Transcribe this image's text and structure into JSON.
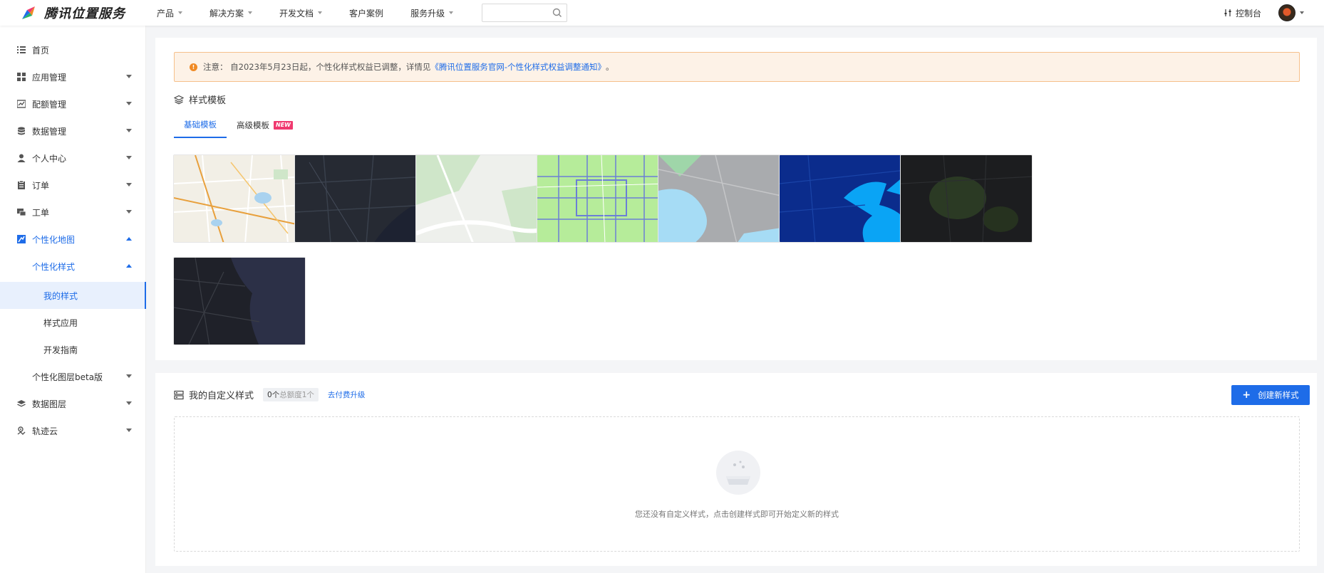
{
  "header": {
    "logo_text": "腾讯位置服务",
    "nav": [
      {
        "label": "产品",
        "has_caret": true
      },
      {
        "label": "解决方案",
        "has_caret": true
      },
      {
        "label": "开发文档",
        "has_caret": true
      },
      {
        "label": "客户案例",
        "has_caret": false
      },
      {
        "label": "服务升级",
        "has_caret": true
      }
    ],
    "search_placeholder": "",
    "console_label": "控制台"
  },
  "sidebar": {
    "items": [
      {
        "label": "首页",
        "icon": "list-icon"
      },
      {
        "label": "应用管理",
        "icon": "grid-icon"
      },
      {
        "label": "配额管理",
        "icon": "chart-icon"
      },
      {
        "label": "数据管理",
        "icon": "database-icon"
      },
      {
        "label": "个人中心",
        "icon": "user-icon"
      },
      {
        "label": "订单",
        "icon": "clipboard-icon"
      },
      {
        "label": "工单",
        "icon": "ticket-icon"
      },
      {
        "label": "个性化地图",
        "icon": "map-style-icon"
      },
      {
        "label": "个性化样式"
      },
      {
        "label": "我的样式"
      },
      {
        "label": "样式应用"
      },
      {
        "label": "开发指南"
      },
      {
        "label": "个性化图层beta版"
      },
      {
        "label": "数据图层",
        "icon": "layers-icon"
      },
      {
        "label": "轨迹云",
        "icon": "track-icon"
      }
    ]
  },
  "notice": {
    "prefix": "注意：  自2023年5月23日起，个性化样式权益已调整，详情见",
    "link": "《腾讯位置服务官网-个性化样式权益调整通知》",
    "suffix": "。"
  },
  "templates": {
    "title": "样式模板",
    "tabs": [
      {
        "label": "基础模板",
        "active": true
      },
      {
        "label": "高级模板",
        "badge": "NEW",
        "active": false
      }
    ],
    "tiles": [
      {
        "name": "standard",
        "bg": "#f2efe6",
        "accent": "#e8a03c"
      },
      {
        "name": "dark-night",
        "bg": "#262a33",
        "accent": "#39404c"
      },
      {
        "name": "light-green",
        "bg": "#eef0ec",
        "accent": "#cfe6c9"
      },
      {
        "name": "fresh-green",
        "bg": "#b6ec9a",
        "accent": "#6b7fd6"
      },
      {
        "name": "gray-water",
        "bg": "#a9abae",
        "accent": "#a6dcf5"
      },
      {
        "name": "deep-blue",
        "bg": "#0b2c8c",
        "accent": "#0aa4f5"
      },
      {
        "name": "black-green",
        "bg": "#1c1d1f",
        "accent": "#2b3a24"
      },
      {
        "name": "midnight",
        "bg": "#1f2129",
        "accent": "#2c3047"
      }
    ]
  },
  "custom": {
    "title": "我的自定义样式",
    "quota_used": "0个",
    "quota_total": "总额度1个",
    "upgrade_link": "去付费升级",
    "create_button": "创建新样式",
    "empty_text": "您还没有自定义样式，点击创建样式即可开始定义新的样式"
  },
  "colors": {
    "primary": "#1e6ce8",
    "notice_bg": "#fdf2e7",
    "notice_border": "#f6c08b",
    "badge": "#f0396f"
  }
}
